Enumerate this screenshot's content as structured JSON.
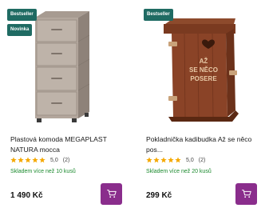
{
  "products": [
    {
      "badges": [
        "Bestseller",
        "Novinka"
      ],
      "title": "Plastová komoda MEGAPLAST NATURA mocca",
      "rating_value": "5,0",
      "rating_count": "(2)",
      "rating_stars": 5,
      "stock": "Skladem více než 10 kusů",
      "price": "1 490 Kč",
      "image_icon": "drawer-chest-image"
    },
    {
      "badges": [
        "Bestseller"
      ],
      "title": "Pokladnička kadibudka Až se něco pos...",
      "rating_value": "5,0",
      "rating_count": "(2)",
      "rating_stars": 5,
      "stock": "Skladem více než 20 kusů",
      "price": "299 Kč",
      "image_icon": "outhouse-moneybox-image",
      "image_text": "AŽ SE NĚCO POSERE"
    }
  ],
  "colors": {
    "badge": "#1f6b63",
    "cart_button": "#8a2d8c",
    "stock": "#1b8a2e",
    "star": "#f5a800"
  }
}
